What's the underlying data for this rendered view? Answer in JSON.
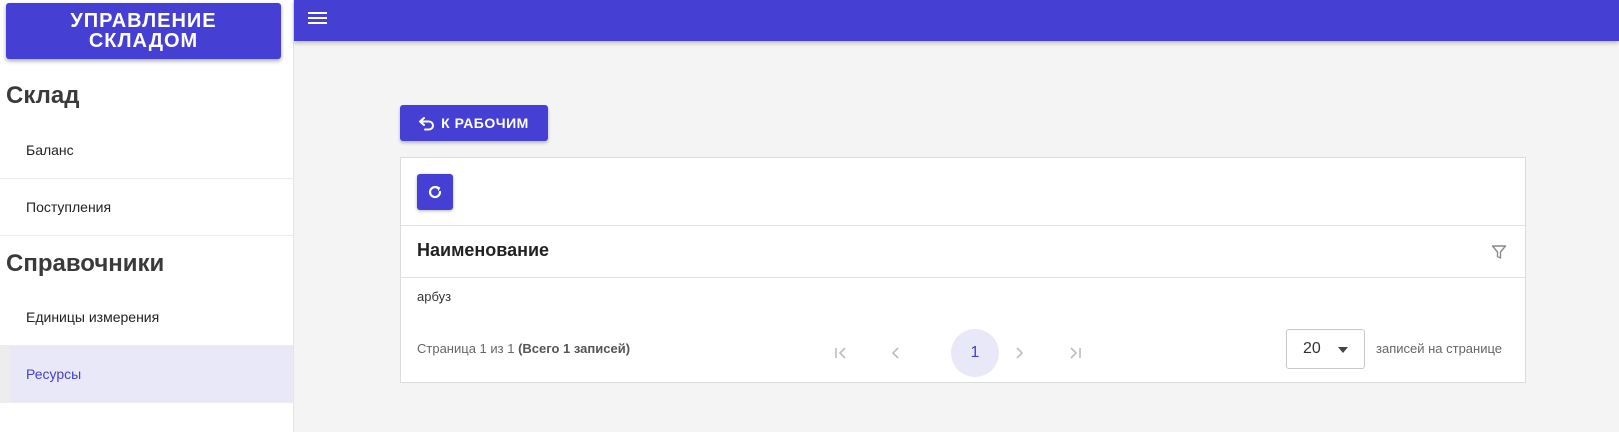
{
  "sidebar": {
    "brand": "УПРАВЛЕНИЕ СКЛАДОМ",
    "sections": [
      {
        "title": "Склад",
        "items": [
          "Баланс",
          "Поступления"
        ]
      },
      {
        "title": "Справочники",
        "items": [
          "Единицы измерения",
          "Ресурсы"
        ]
      }
    ],
    "active_item": "Ресурсы"
  },
  "topbar": {
    "menu_icon": "hamburger-menu-icon"
  },
  "actions": {
    "back_label": "К РАБОЧИМ",
    "back_icon": "undo-icon",
    "refresh_icon": "refresh-icon"
  },
  "table": {
    "columns": [
      "Наименование"
    ],
    "filter_icon": "filter-icon",
    "rows": [
      [
        "арбуз"
      ]
    ]
  },
  "paginator": {
    "report_prefix": "Страница 1 из 1",
    "report_total": "(Всего 1 записей)",
    "current_page": "1",
    "rows_per_page": "20",
    "rows_label": "записей на странице"
  },
  "colors": {
    "accent": "#4540d3",
    "active_bg": "#e9e8f8",
    "background": "#f4f4f4"
  }
}
